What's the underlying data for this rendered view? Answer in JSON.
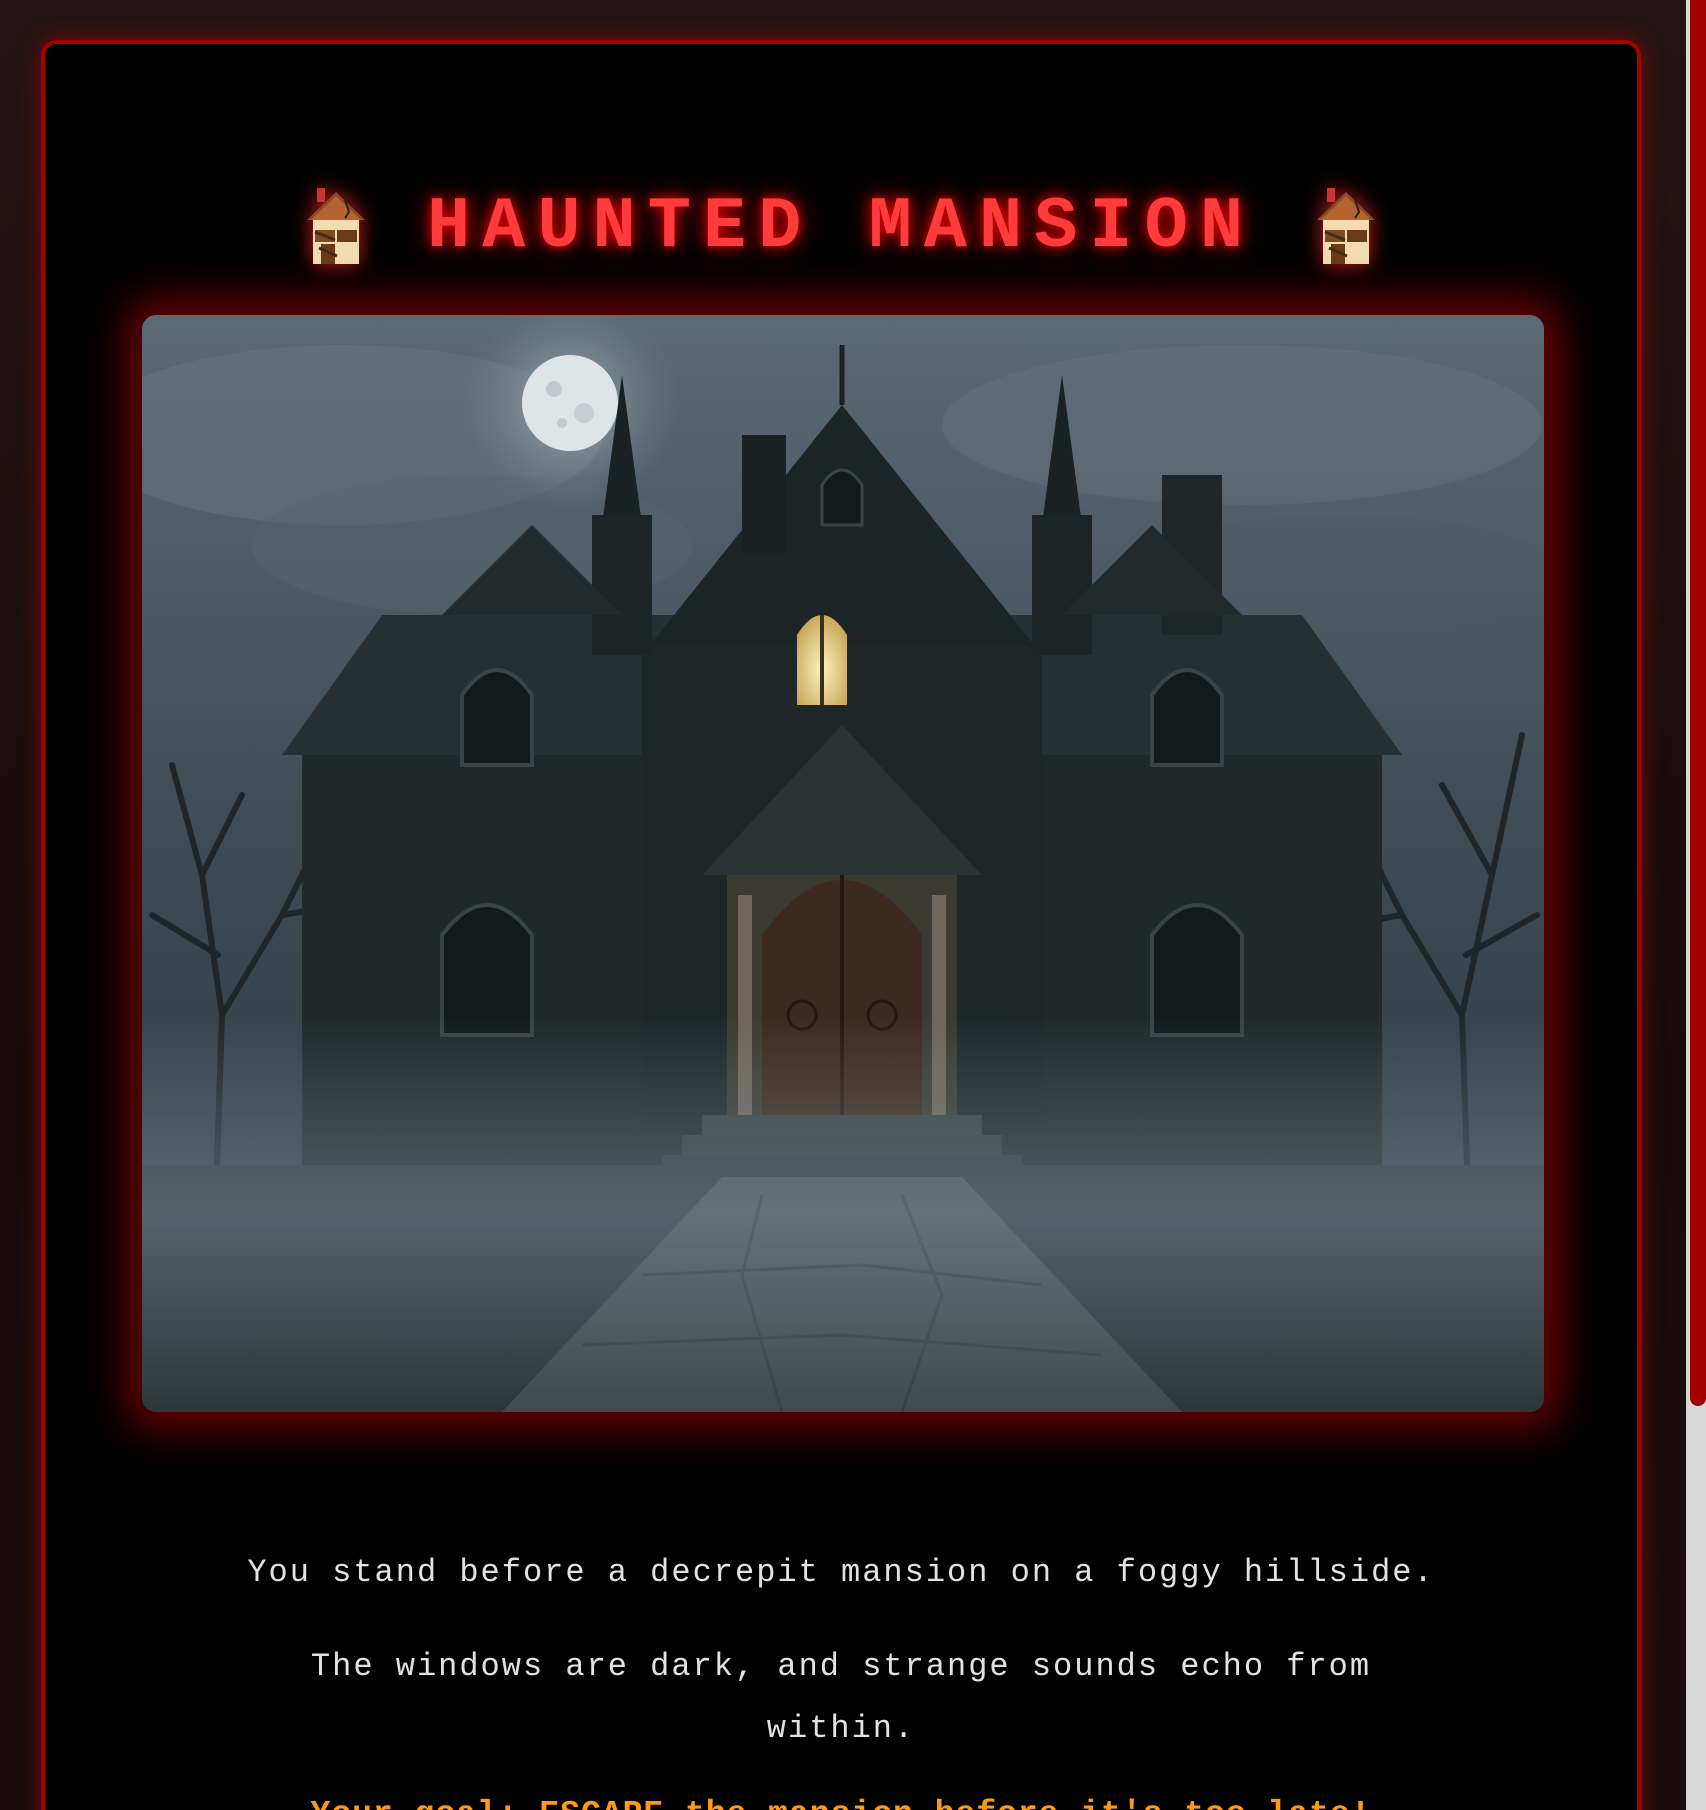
{
  "header": {
    "title": "HAUNTED MANSION",
    "left_icon": "derelict-house-icon",
    "right_icon": "derelict-house-icon"
  },
  "scene": {
    "image_subject": "haunted-mansion-night-scene"
  },
  "story": {
    "line1": "You stand before a decrepit mansion on a foggy hillside.",
    "line2": "The windows are dark, and strange sounds echo from within.",
    "goal": "Your goal: ESCAPE the mansion before it's too late!"
  },
  "colors": {
    "accent_red": "#ff3b3b",
    "border_red": "#a50000",
    "goal_orange": "#ff9a12",
    "body_text": "#e2e2e2",
    "panel_bg": "#000000"
  }
}
